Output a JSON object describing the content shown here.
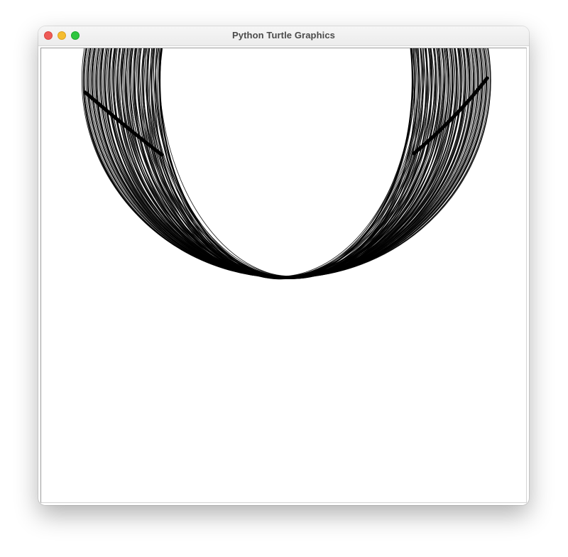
{
  "window": {
    "title": "Python Turtle Graphics"
  },
  "controls": {
    "close_color": "#ee5b57",
    "minimize_color": "#f5bd2f",
    "maximize_color": "#2fc63f"
  },
  "canvas": {
    "background_color": "#ffffff",
    "pen_color": "#000000"
  }
}
